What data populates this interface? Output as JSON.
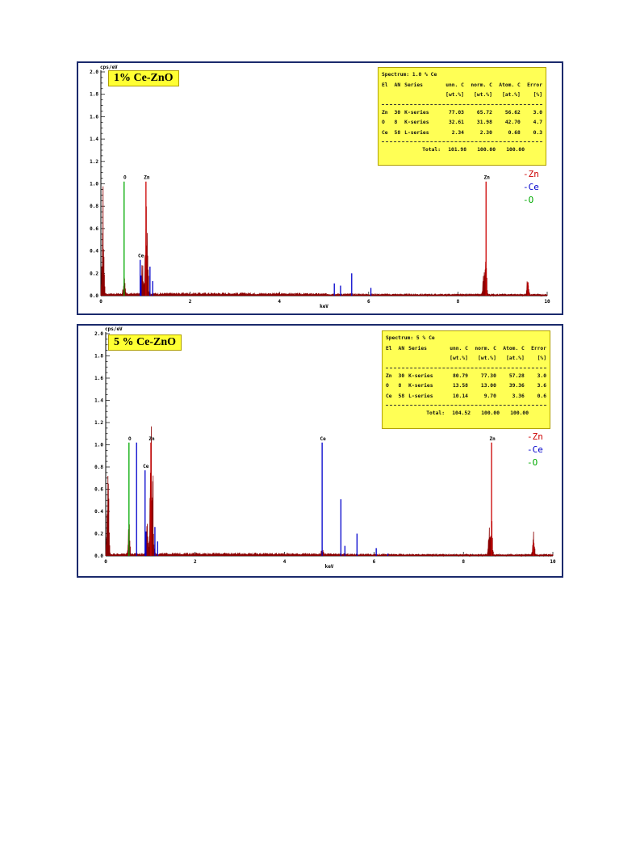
{
  "charts": [
    {
      "label": "1% Ce-ZnO",
      "y_unit": "cps/eV",
      "table": {
        "title": "Spectrum: 1.0 % Ce",
        "headers": [
          "El",
          "AN",
          "Series",
          "unn. C",
          "norm. C",
          "Atom. C",
          "Error"
        ],
        "units": [
          "[wt.%]",
          "[wt.%]",
          "[at.%]",
          "[%]"
        ],
        "rows": [
          {
            "el": "Zn",
            "an": "30",
            "series": "K-series",
            "unn": "77.03",
            "norm": "65.72",
            "atom": "56.62",
            "error": "3.0"
          },
          {
            "el": "O",
            "an": "8",
            "series": "K-series",
            "unn": "32.61",
            "norm": "31.98",
            "atom": "42.70",
            "error": "4.7"
          },
          {
            "el": "Ce",
            "an": "58",
            "series": "L-series",
            "unn": "2.34",
            "norm": "2.30",
            "atom": "0.68",
            "error": "0.3"
          }
        ],
        "total_label": "Total:",
        "total": {
          "unn": "101.98",
          "norm": "100.00",
          "atom": "100.00"
        }
      }
    },
    {
      "label": "5 % Ce-ZnO",
      "y_unit": "cps/eV",
      "table": {
        "title": "Spectrum: 5 % Ce",
        "headers": [
          "El",
          "AN",
          "Series",
          "unn. C",
          "norm. C",
          "Atom. C",
          "Error"
        ],
        "units": [
          "[wt.%]",
          "[wt.%]",
          "[at.%]",
          "[%]"
        ],
        "rows": [
          {
            "el": "Zn",
            "an": "30",
            "series": "K-series",
            "unn": "80.79",
            "norm": "77.30",
            "atom": "57.28",
            "error": "3.0"
          },
          {
            "el": "O",
            "an": "8",
            "series": "K-series",
            "unn": "13.58",
            "norm": "13.00",
            "atom": "39.36",
            "error": "3.6"
          },
          {
            "el": "Ce",
            "an": "58",
            "series": "L-series",
            "unn": "10.14",
            "norm": "9.70",
            "atom": "3.36",
            "error": "0.6"
          }
        ],
        "total_label": "Total:",
        "total": {
          "unn": "104.52",
          "norm": "100.00",
          "atom": "100.00"
        }
      }
    }
  ],
  "chart_data": [
    {
      "type": "bar",
      "xlabel": "keV",
      "ylabel": "cps/eV",
      "xlim": [
        0,
        10
      ],
      "ylim": [
        0,
        2.0
      ],
      "xticks": [
        0,
        2,
        4,
        6,
        8,
        10
      ],
      "yticks": [
        0.0,
        0.2,
        0.4,
        0.6,
        0.8,
        1.0,
        1.2,
        1.4,
        1.6,
        1.8,
        2.0
      ],
      "legend": [
        "Zn",
        "Ce",
        "O"
      ],
      "legend_position": "right",
      "colors": {
        "Zn": "#cc0000",
        "Ce": "#0000cc",
        "O": "#00aa00",
        "spectrum": "#8b0000"
      },
      "spectrum_peaks": [
        [
          0.05,
          0.7
        ],
        [
          0.52,
          0.12
        ],
        [
          0.93,
          0.2
        ],
        [
          1.01,
          0.65
        ],
        [
          1.04,
          0.5
        ],
        [
          8.63,
          0.23
        ],
        [
          8.58,
          0.16
        ],
        [
          9.57,
          0.15
        ]
      ],
      "lines": [
        {
          "element": "O",
          "energy": 0.52,
          "height": 1.02,
          "label": "O"
        },
        {
          "element": "Zn",
          "energy": 1.01,
          "height": 1.02,
          "label": "Zn"
        },
        {
          "element": "Zn",
          "energy": 8.63,
          "height": 1.02,
          "label": "Zn"
        },
        {
          "element": "Zn",
          "energy": 9.57,
          "height": 0.12,
          "label": ""
        },
        {
          "element": "Ce",
          "energy": 0.88,
          "height": 0.32,
          "label": "Ce"
        },
        {
          "element": "Ce",
          "energy": 0.9,
          "height": 0.18,
          "label": ""
        },
        {
          "element": "Ce",
          "energy": 1.1,
          "height": 0.26,
          "label": ""
        },
        {
          "element": "Ce",
          "energy": 1.16,
          "height": 0.13,
          "label": ""
        },
        {
          "element": "Ce",
          "energy": 5.23,
          "height": 0.11,
          "label": ""
        },
        {
          "element": "Ce",
          "energy": 5.37,
          "height": 0.09,
          "label": ""
        },
        {
          "element": "Ce",
          "energy": 5.62,
          "height": 0.2,
          "label": ""
        },
        {
          "element": "Ce",
          "energy": 6.05,
          "height": 0.07,
          "label": ""
        }
      ]
    },
    {
      "type": "bar",
      "xlabel": "keV",
      "ylabel": "cps/eV",
      "xlim": [
        0,
        10
      ],
      "ylim": [
        0,
        2.0
      ],
      "xticks": [
        0,
        2,
        4,
        6,
        8,
        10
      ],
      "yticks": [
        0.0,
        0.2,
        0.4,
        0.6,
        0.8,
        1.0,
        1.2,
        1.4,
        1.6,
        1.8,
        2.0
      ],
      "legend": [
        "Zn",
        "Ce",
        "O"
      ],
      "legend_position": "right",
      "colors": {
        "Zn": "#cc0000",
        "Ce": "#0000cc",
        "O": "#00aa00",
        "spectrum": "#8b0000"
      },
      "spectrum_peaks": [
        [
          0.05,
          0.72
        ],
        [
          0.52,
          0.24
        ],
        [
          0.93,
          0.22
        ],
        [
          1.01,
          0.85
        ],
        [
          1.05,
          0.55
        ],
        [
          8.63,
          0.25
        ],
        [
          8.58,
          0.18
        ],
        [
          9.57,
          0.14
        ],
        [
          4.84,
          0.04
        ]
      ],
      "lines": [
        {
          "element": "O",
          "energy": 0.52,
          "height": 1.02,
          "label": "O"
        },
        {
          "element": "Zn",
          "energy": 1.01,
          "height": 1.02,
          "label": "Zn"
        },
        {
          "element": "Zn",
          "energy": 8.63,
          "height": 1.02,
          "label": "Zn"
        },
        {
          "element": "Zn",
          "energy": 9.57,
          "height": 0.12,
          "label": ""
        },
        {
          "element": "Ce",
          "energy": 0.69,
          "height": 1.02,
          "label": ""
        },
        {
          "element": "Ce",
          "energy": 0.88,
          "height": 0.77,
          "label": "Ce"
        },
        {
          "element": "Ce",
          "energy": 0.9,
          "height": 0.22,
          "label": ""
        },
        {
          "element": "Ce",
          "energy": 1.1,
          "height": 0.26,
          "label": ""
        },
        {
          "element": "Ce",
          "energy": 1.16,
          "height": 0.13,
          "label": ""
        },
        {
          "element": "Ce",
          "energy": 4.84,
          "height": 1.02,
          "label": "Ce"
        },
        {
          "element": "Ce",
          "energy": 5.26,
          "height": 0.51,
          "label": ""
        },
        {
          "element": "Ce",
          "energy": 5.35,
          "height": 0.09,
          "label": ""
        },
        {
          "element": "Ce",
          "energy": 5.62,
          "height": 0.2,
          "label": ""
        },
        {
          "element": "Ce",
          "energy": 6.05,
          "height": 0.07,
          "label": ""
        },
        {
          "element": "Ce",
          "energy": 6.31,
          "height": 0.02,
          "label": ""
        }
      ]
    }
  ]
}
